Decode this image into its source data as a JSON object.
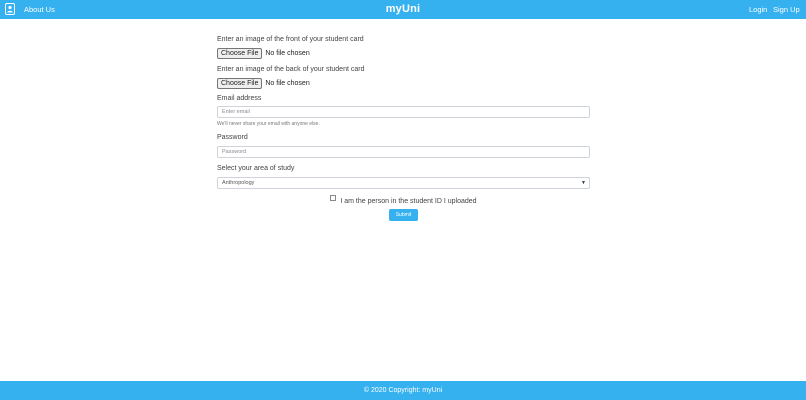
{
  "navbar": {
    "about_label": "About Us",
    "brand": "myUni",
    "login_label": "Login",
    "signup_label": "Sign Up",
    "logo_icon": "student-card-icon"
  },
  "form": {
    "front_label": "Enter an image of the front of your student card",
    "back_label": "Enter an image of the back of your student card",
    "file_button_label": "Choose File",
    "file_status": "No file chosen",
    "email_label": "Email address",
    "email_placeholder": "Enter email",
    "email_help": "We'll never share your email with anyone else.",
    "password_label": "Password",
    "password_placeholder": "Password",
    "study_label": "Select your area of study",
    "study_selected": "Anthropology",
    "checkbox_label": "I am the person in the student ID I uploaded",
    "submit_label": "Submit"
  },
  "footer": {
    "copyright": "© 2020 Copyright: myUni"
  },
  "colors": {
    "primary": "#36b1f0"
  }
}
